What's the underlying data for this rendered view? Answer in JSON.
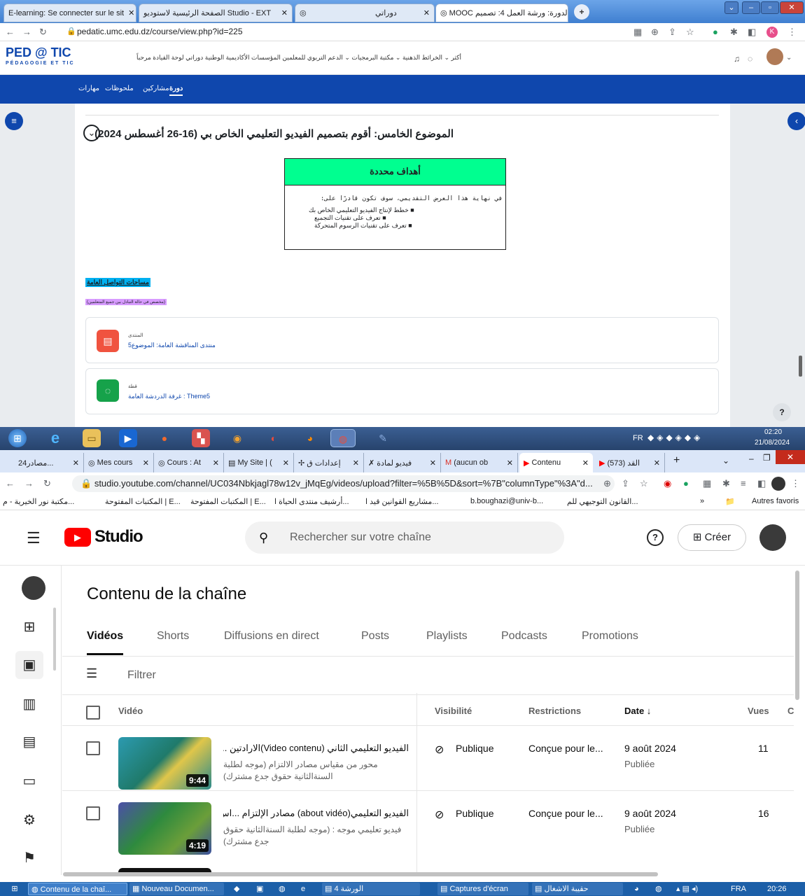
{
  "top_window": {
    "tabs": [
      {
        "label": "E-learning: Se connecter sur le sit"
      },
      {
        "label": "الصفحة الرئيسية لاستوديو Studio - EXT"
      },
      {
        "label": ""
      },
      {
        "label": "دوراتي"
      },
      {
        "label": "MOOC الدورة: ورشة العمل 4: تصميم"
      }
    ],
    "new_tab": "+",
    "url": "pedatic.umc.edu.dz/course/view.php?id=225",
    "site": {
      "logo_main": "PED @ TIC",
      "logo_sub": "PÉDAGOGIE ET TIC",
      "menu": "أكثر ⌄  الخرائط الذهنية ⌄  مكتبة البرمجيات ⌄  الدعم التربوي للمعلمين   المؤسسات الأكاديمية الوطنية   دوراتي   لوحة القيادة   مرحباً",
      "nav_items": [
        "مهارات",
        "ملحوظات",
        "مشاركين",
        "دورة"
      ]
    },
    "topic_title": "الموضوع الخامس: أقوم بتصميم الفيديو التعليمي الخاص بي (16-26 أغسطس 2024)",
    "objectives": {
      "header": "أهداف محددة",
      "intro": "في نهاية هذا العرض التقديمي، سوف تكون قادرًا على:",
      "items": [
        "خطط لإنتاج الفيديو التعليمي الخاص بك",
        "تعرف على تقنيات التجميع",
        "تعرف على تقنيات الرسوم المتحركة"
      ]
    },
    "space_title": "مساحات التواصل العامة",
    "space_note": "(مخصص في حالة التبادل بين جميع المتعلمين)",
    "activities": [
      {
        "type": "المنتدى",
        "link": "منتدى المناقشة العامة: الموضوع5",
        "color": "#f0533f",
        "icon": "forum-icon"
      },
      {
        "type": "قطة",
        "link": "غرفة الدردشة العامة : Theme5",
        "color": "#16a24a",
        "icon": "chat-icon"
      }
    ],
    "help": "?"
  },
  "taskbar_top": {
    "lang": "FR",
    "time": "02:20",
    "date": "21/08/2024"
  },
  "bottom_window": {
    "tabs": [
      {
        "label": "مصادر24..."
      },
      {
        "label": "Mes cours"
      },
      {
        "label": "Cours : At"
      },
      {
        "label": "My Site | ("
      },
      {
        "label": "إعدادات ق"
      },
      {
        "label": "فيديو لمادة"
      },
      {
        "label": "(aucun ob"
      },
      {
        "label": "Contenu"
      },
      {
        "label": "(573) القد"
      }
    ],
    "url": "studio.youtube.com/channel/UC034Nbkjagl78w12v_jMqEg/videos/upload?filter=%5B%5D&sort=%7B\"columnType\"%3A\"d...",
    "bookmarks": [
      "مكتبة نور الخيرية - م...",
      "المكتبات المفتوحة | E...",
      "المكتبات المفتوحة | E...",
      "أرشيف منتدى الحياة ا...",
      "مشاريع القوانين قيد ا...",
      "b.boughazi@univ-b...",
      "القانون التوجيهي للم...",
      "»",
      "Autres favoris"
    ],
    "studio": {
      "logo": "Studio",
      "search_placeholder": "Rechercher sur votre chaîne",
      "create_label": "Créer",
      "page_title": "Contenu de la chaîne",
      "tabs": [
        "Vidéos",
        "Shorts",
        "Diffusions en direct",
        "Posts",
        "Playlists",
        "Podcasts",
        "Promotions"
      ],
      "filter_label": "Filtrer",
      "columns": {
        "video": "Vidéo",
        "visibility": "Visibilité",
        "restrictions": "Restrictions",
        "date": "Date ↓",
        "views": "Vues",
        "c": "C"
      },
      "rows": [
        {
          "title": "الفيديو التعليمي الثاني (Video contenu)الارادتين ...",
          "desc": "محور من مقياس مصادر الالتزام (موجه لطلبة السنةالثانية حقوق جدع مشترك)",
          "duration": "9:44",
          "visibility": "Publique",
          "restrictions": "Conçue pour le...",
          "date": "9 août 2024",
          "status": "Publiée",
          "views": "11"
        },
        {
          "title": "الفيديو التعليمي(about vidéo) مصادر الإلتزام ...اس",
          "desc": "فيديو تعليمي موجه : (موجه لطلبة السنةالثانية حقوق جدع مشترك)",
          "duration": "4:19",
          "visibility": "Publique",
          "restrictions": "Conçue pour le...",
          "date": "9 août 2024",
          "status": "Publiée",
          "views": "16"
        }
      ]
    }
  },
  "taskbar_bottom": {
    "items": [
      "Contenu de la chaî...",
      "Nouveau Documen...",
      "الورشة 4",
      "Captures d'écran",
      "حقيبة الاشغال"
    ],
    "lang": "FRA",
    "time": "20:26"
  },
  "colors": {
    "ped_blue": "#0f47ad",
    "yt_red": "#ff0000",
    "obj_green": "#00ff90"
  }
}
